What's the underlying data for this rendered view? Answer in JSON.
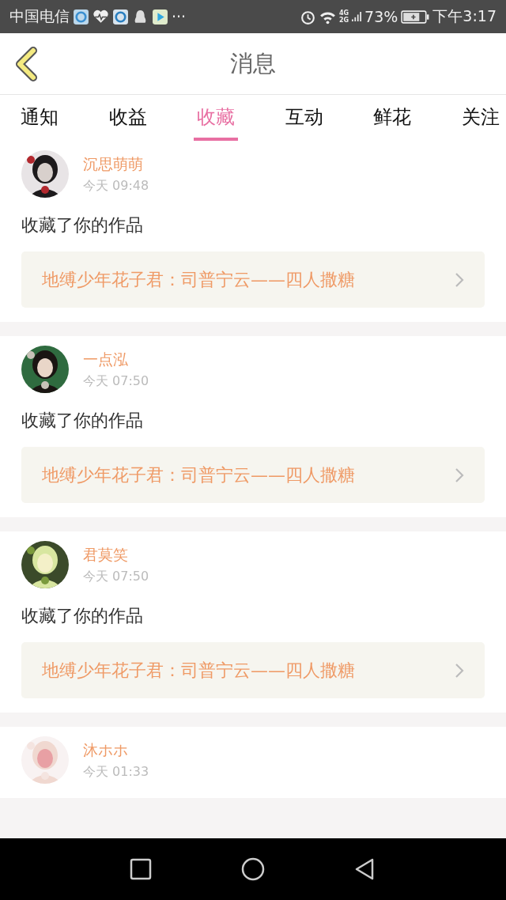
{
  "status_bar": {
    "carrier": "中国电信",
    "more": "···",
    "network_top": "4G",
    "network_bottom": "2G",
    "battery": "73%",
    "time": "下午3:17"
  },
  "header": {
    "title": "消息"
  },
  "tabs": [
    {
      "label": "通知",
      "selected": false
    },
    {
      "label": "收益",
      "selected": false
    },
    {
      "label": "收藏",
      "selected": true
    },
    {
      "label": "互动",
      "selected": false
    },
    {
      "label": "鲜花",
      "selected": false
    },
    {
      "label": "关注",
      "selected": false
    }
  ],
  "messages": [
    {
      "user": "沉思萌萌",
      "time": "今天 09:48",
      "text": "收藏了你的作品",
      "work": "地缚少年花子君：司普宁云——四人撒糖"
    },
    {
      "user": "一点泓",
      "time": "今天 07:50",
      "text": "收藏了你的作品",
      "work": "地缚少年花子君：司普宁云——四人撒糖"
    },
    {
      "user": "君莫笑",
      "time": "今天 07:50",
      "text": "收藏了你的作品",
      "work": "地缚少年花子君：司普宁云——四人撒糖"
    },
    {
      "user": "沐ホホ",
      "time": "今天 01:33"
    }
  ]
}
